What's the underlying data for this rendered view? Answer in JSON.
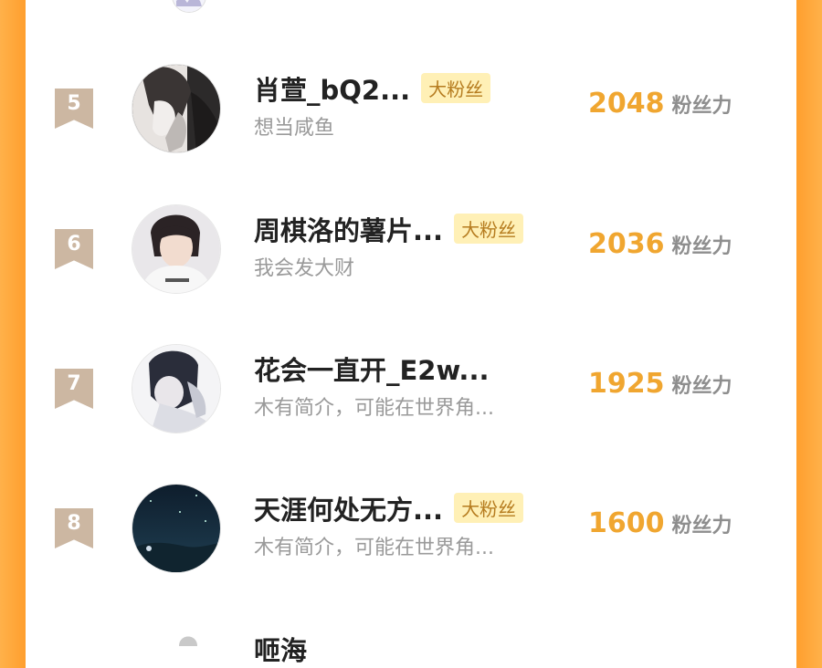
{
  "badge_label": "大粉丝",
  "score_unit": "粉丝力",
  "rows": [
    {
      "rank": "5",
      "name": "肖萱_bQ2...",
      "badge": true,
      "bio": "想当咸鱼",
      "score": "2048",
      "avatar_icon": "avatar-dark-portrait"
    },
    {
      "rank": "6",
      "name": "周棋洛的薯片...",
      "badge": true,
      "bio": "我会发大财",
      "score": "2036",
      "avatar_icon": "avatar-selfie"
    },
    {
      "rank": "7",
      "name": "花会一直开_E2w...",
      "badge": false,
      "bio": "木有简介，可能在世界角...",
      "score": "1925",
      "avatar_icon": "avatar-soft-portrait"
    },
    {
      "rank": "8",
      "name": "天涯何处无方...",
      "badge": true,
      "bio": "木有简介，可能在世界角...",
      "score": "1600",
      "avatar_icon": "avatar-night-sky"
    }
  ],
  "partial_next": {
    "name": "咂海"
  }
}
